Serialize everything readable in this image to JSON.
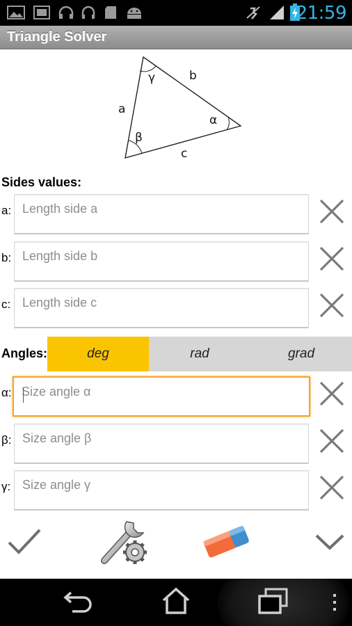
{
  "status_bar": {
    "time": "21:59",
    "icons": [
      "gallery-icon",
      "screenshot-icon",
      "headphones-icon",
      "headset-icon",
      "sd-card-icon",
      "android-icon",
      "mute-icon",
      "signal-icon",
      "battery-charging-icon"
    ]
  },
  "app": {
    "title": "Triangle Solver"
  },
  "diagram": {
    "side_a": "a",
    "side_b": "b",
    "side_c": "c",
    "angle_alpha": "α",
    "angle_beta": "β",
    "angle_gamma": "γ"
  },
  "sides": {
    "heading": "Sides values:",
    "rows": [
      {
        "label": "a:",
        "placeholder": "Length side a",
        "value": ""
      },
      {
        "label": "b:",
        "placeholder": "Length side b",
        "value": ""
      },
      {
        "label": "c:",
        "placeholder": "Length side c",
        "value": ""
      }
    ]
  },
  "angles": {
    "heading": "Angles:",
    "units": [
      {
        "label": "deg",
        "selected": true
      },
      {
        "label": "rad",
        "selected": false
      },
      {
        "label": "grad",
        "selected": false
      }
    ],
    "rows": [
      {
        "label": "α:",
        "placeholder": "Size angle α",
        "value": ""
      },
      {
        "label": "β:",
        "placeholder": "Size angle β",
        "value": ""
      },
      {
        "label": "γ:",
        "placeholder": "Size angle γ",
        "value": ""
      }
    ]
  },
  "actions": [
    "check-icon",
    "settings-wrench-icon",
    "eraser-icon",
    "chevron-down-icon"
  ],
  "nav": [
    "back-icon",
    "home-icon",
    "recent-apps-icon",
    "overflow-menu-icon"
  ],
  "colors": {
    "accent_selected": "#fbc400",
    "focus_border": "#f5a623",
    "time": "#33b5e5"
  }
}
